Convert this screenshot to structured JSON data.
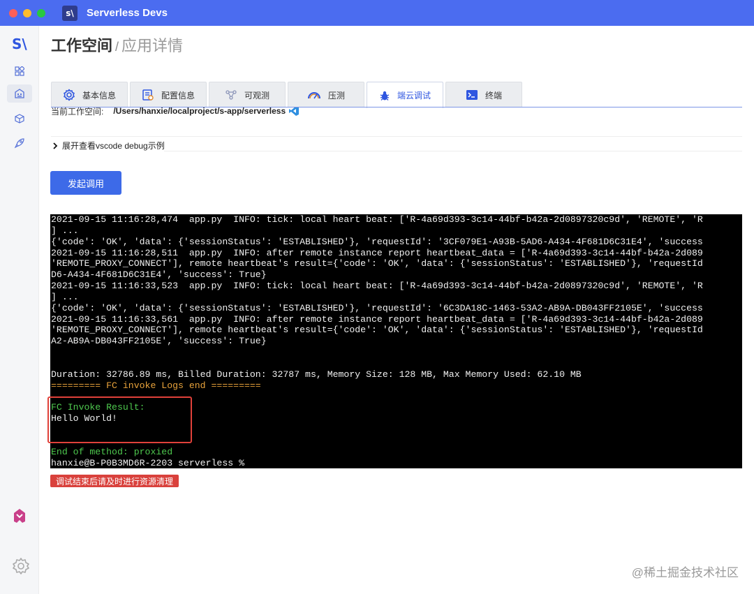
{
  "app": {
    "title": "Serverless Devs",
    "logo_text": "s\\"
  },
  "sidebar": {
    "logo_text": "S\\",
    "items": [
      {
        "icon": "grid-icon",
        "active": false
      },
      {
        "icon": "app-store-icon",
        "active": true
      },
      {
        "icon": "cube-icon",
        "active": false
      },
      {
        "icon": "rocket-icon",
        "active": false
      }
    ],
    "bottom_icons": [
      "brand-logo-icon",
      "gear-icon"
    ]
  },
  "breadcrumb": {
    "root": "工作空间",
    "separator": "/",
    "leaf": "应用详情"
  },
  "tabs": [
    {
      "label": "基本信息",
      "icon": "gear-icon",
      "active": false
    },
    {
      "label": "配置信息",
      "icon": "config-icon",
      "active": false
    },
    {
      "label": "可观测",
      "icon": "observe-icon",
      "active": false
    },
    {
      "label": "压测",
      "icon": "gauge-icon",
      "active": false
    },
    {
      "label": "端云调试",
      "icon": "bug-icon",
      "active": true
    },
    {
      "label": "终端",
      "icon": "terminal-icon",
      "active": false
    }
  ],
  "workspace": {
    "label": "当前工作空间:",
    "path": "/Users/hanxie/localproject/s-app/serverless"
  },
  "expander": {
    "label": "展开查看vscode debug示例"
  },
  "invoke_button": {
    "label": "发起调用"
  },
  "terminal": {
    "lines": [
      {
        "text": "2021-09-15 11:16:28,474  app.py  INFO: tick: local heart beat: ['R-4a69d393-3c14-44bf-b42a-2d0897320c9d', 'REMOTE', 'R",
        "style": ""
      },
      {
        "text": "] ...",
        "style": ""
      },
      {
        "text": "{'code': 'OK', 'data': {'sessionStatus': 'ESTABLISHED'}, 'requestId': '3CF079E1-A93B-5AD6-A434-4F681D6C31E4', 'success",
        "style": ""
      },
      {
        "text": "2021-09-15 11:16:28,511  app.py  INFO: after remote instance report heartbeat_data = ['R-4a69d393-3c14-44bf-b42a-2d089",
        "style": ""
      },
      {
        "text": "'REMOTE_PROXY_CONNECT'], remote heartbeat's result={'code': 'OK', 'data': {'sessionStatus': 'ESTABLISHED'}, 'requestId",
        "style": ""
      },
      {
        "text": "D6-A434-4F681D6C31E4', 'success': True}",
        "style": ""
      },
      {
        "text": "2021-09-15 11:16:33,523  app.py  INFO: tick: local heart beat: ['R-4a69d393-3c14-44bf-b42a-2d0897320c9d', 'REMOTE', 'R",
        "style": ""
      },
      {
        "text": "] ...",
        "style": ""
      },
      {
        "text": "{'code': 'OK', 'data': {'sessionStatus': 'ESTABLISHED'}, 'requestId': '6C3DA18C-1463-53A2-AB9A-DB043FF2105E', 'success",
        "style": ""
      },
      {
        "text": "2021-09-15 11:16:33,561  app.py  INFO: after remote instance report heartbeat_data = ['R-4a69d393-3c14-44bf-b42a-2d089",
        "style": ""
      },
      {
        "text": "'REMOTE_PROXY_CONNECT'], remote heartbeat's result={'code': 'OK', 'data': {'sessionStatus': 'ESTABLISHED'}, 'requestId",
        "style": ""
      },
      {
        "text": "A2-AB9A-DB043FF2105E', 'success': True}",
        "style": ""
      },
      {
        "text": "",
        "style": ""
      },
      {
        "text": "",
        "style": ""
      },
      {
        "text": "Duration: 32786.89 ms, Billed Duration: 32787 ms, Memory Size: 128 MB, Max Memory Used: 62.10 MB",
        "style": ""
      },
      {
        "text": "========= FC invoke Logs end =========",
        "style": "orange"
      },
      {
        "text": "",
        "style": ""
      },
      {
        "text": "FC Invoke Result:",
        "style": "green"
      },
      {
        "text": "Hello World!",
        "style": ""
      },
      {
        "text": "",
        "style": ""
      },
      {
        "text": "",
        "style": ""
      },
      {
        "text": "End of method: proxied",
        "style": "green"
      },
      {
        "text": "hanxie@B-P0B3MD6R-2203 serverless %",
        "style": ""
      }
    ]
  },
  "cleanup_badge": {
    "label": "调试结束后请及时进行资源清理"
  },
  "watermark": {
    "text": "@稀土掘金技术社区"
  },
  "colors": {
    "titlebar": "#4b6cf0",
    "accent": "#3d6ae8",
    "danger": "#d9413c",
    "terminal_bg": "#000000"
  }
}
